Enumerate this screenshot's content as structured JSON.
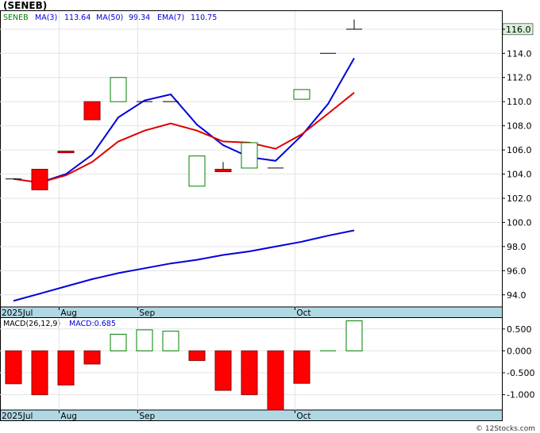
{
  "header": {
    "title": "(SENEB)",
    "legend": {
      "symbol": "SENEB",
      "ma3": "MA(3)",
      "ma3_value": "113.64",
      "ma50": "MA(50)",
      "ma50_value": "99.34",
      "ema7": "EMA(7)",
      "ema7_value": "110.75"
    }
  },
  "macd_legend": {
    "label": "MACD(26,12,9)",
    "value": "MACD:0.685"
  },
  "footer": {
    "credit": "© 12Stocks.com"
  },
  "price_label": "116.0",
  "colors": {
    "up": "#008000",
    "down": "#ff0000",
    "ma_short": "#0000dd",
    "ma_long": "#0000dd",
    "ema": "#dd0000",
    "axis_band": "#b0d8e4",
    "price_tag": "#d8f0d8"
  },
  "chart_data": [
    {
      "type": "candlestick",
      "title": "(SENEB)",
      "ylim": [
        93,
        117.5
      ],
      "yticks": [
        94,
        96,
        98,
        100,
        102,
        104,
        106,
        108,
        110,
        112,
        114,
        116
      ],
      "ytick_labels": [
        "94.0",
        "96.0",
        "98.0",
        "100.0",
        "102.0",
        "104.0",
        "106.0",
        "108.0",
        "110.0",
        "112.0",
        "114.0",
        "116.0"
      ],
      "xticks": [
        {
          "label": "2025Jul",
          "index": -0.6
        },
        {
          "label": "Aug",
          "index": 1.8
        },
        {
          "label": "Sep",
          "index": 4.8
        },
        {
          "label": "Oct",
          "index": 10.8
        }
      ],
      "candles": [
        {
          "open": 103.6,
          "close": 103.6,
          "high": 103.6,
          "low": 103.6
        },
        {
          "open": 104.4,
          "close": 102.7,
          "high": 104.4,
          "low": 102.7
        },
        {
          "open": 105.9,
          "close": 105.8,
          "high": 105.9,
          "low": 105.8
        },
        {
          "open": 110.0,
          "close": 108.5,
          "high": 110.0,
          "low": 108.5
        },
        {
          "open": 110.0,
          "close": 112.0,
          "high": 112.0,
          "low": 110.0
        },
        {
          "open": 110.0,
          "close": 110.0,
          "high": 110.0,
          "low": 110.0
        },
        {
          "open": 110.0,
          "close": 110.0,
          "high": 110.0,
          "low": 110.0
        },
        {
          "open": 103.0,
          "close": 105.5,
          "high": 105.5,
          "low": 103.0
        },
        {
          "open": 104.4,
          "close": 104.2,
          "high": 105.0,
          "low": 104.2
        },
        {
          "open": 104.5,
          "close": 106.6,
          "high": 106.6,
          "low": 104.5
        },
        {
          "open": 104.5,
          "close": 104.5,
          "high": 104.5,
          "low": 104.5
        },
        {
          "open": 110.2,
          "close": 111.0,
          "high": 111.0,
          "low": 110.2
        },
        {
          "open": 114.0,
          "close": 114.0,
          "high": 114.0,
          "low": 114.0
        },
        {
          "open": 116.0,
          "close": 116.0,
          "high": 116.8,
          "low": 116.0
        }
      ],
      "series": [
        {
          "name": "MA(3)",
          "key": "ma3",
          "values": [
            null,
            103.3,
            104.0,
            105.6,
            108.7,
            110.1,
            110.6,
            108.1,
            106.4,
            105.4,
            105.1,
            107.2,
            109.8,
            113.6
          ]
        },
        {
          "name": "MA(50)",
          "key": "ma50",
          "values": [
            93.5,
            94.1,
            94.7,
            95.3,
            95.8,
            96.2,
            96.6,
            96.9,
            97.3,
            97.6,
            98.0,
            98.4,
            98.9,
            99.34
          ]
        },
        {
          "name": "EMA(7)",
          "key": "ema7",
          "values": [
            103.6,
            103.3,
            103.9,
            105.0,
            106.7,
            107.6,
            108.2,
            107.6,
            106.7,
            106.6,
            106.1,
            107.3,
            109.0,
            110.75
          ]
        }
      ]
    },
    {
      "type": "bar",
      "title": "MACD(26,12,9)",
      "ylim": [
        -1.35,
        0.75
      ],
      "yticks": [
        0.5,
        0.0,
        -0.5,
        -1.0
      ],
      "ytick_labels": [
        "0.500",
        "0.000",
        "-0.500",
        "-1.000"
      ],
      "series": [
        {
          "name": "MACD",
          "values": [
            -0.75,
            -1.0,
            -0.78,
            -0.3,
            0.38,
            0.48,
            0.45,
            -0.22,
            -0.9,
            -1.0,
            -1.35,
            -0.74,
            0.0,
            0.685
          ]
        }
      ]
    }
  ]
}
